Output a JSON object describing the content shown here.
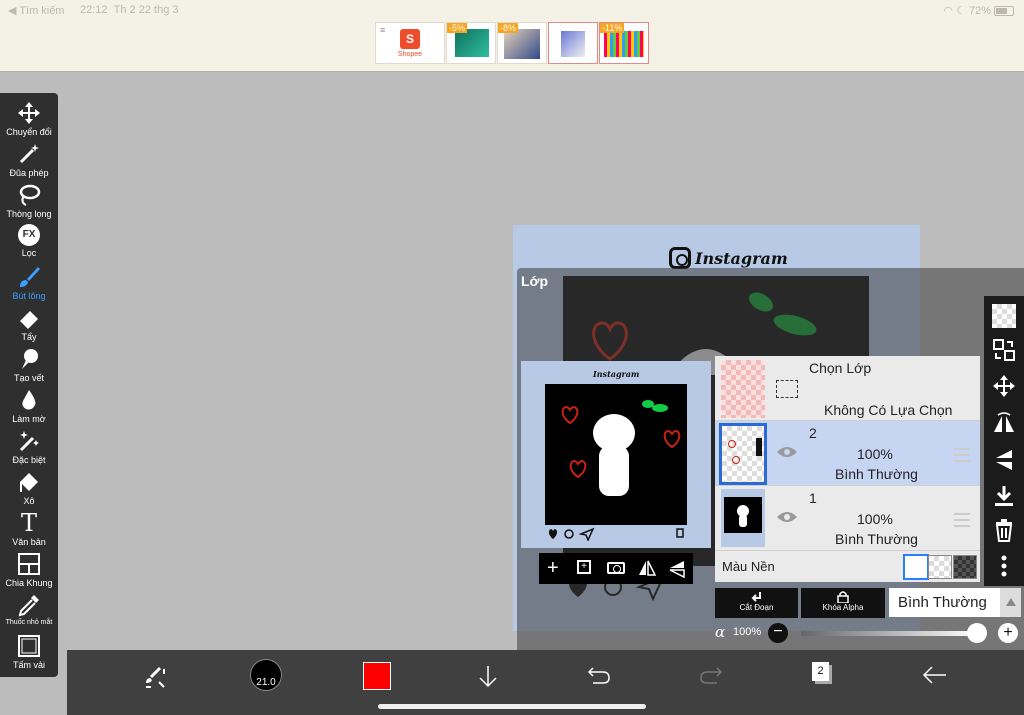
{
  "status": {
    "back": "◀ Tìm kiếm",
    "time": "22:12",
    "date": "Th 2 22 thg 3",
    "battery": "72%"
  },
  "ads": {
    "shopee": "Shopee",
    "badge1": "-5%",
    "badge2": "-8%",
    "badge3": "-11%"
  },
  "toolbar": {
    "items": [
      {
        "label": "Chuyển đổi"
      },
      {
        "label": "Đũa phép"
      },
      {
        "label": "Thòng lọng"
      },
      {
        "label": "Lọc"
      },
      {
        "label": "Bút lông"
      },
      {
        "label": "Tẩy"
      },
      {
        "label": "Tạo vết"
      },
      {
        "label": "Làm mờ"
      },
      {
        "label": "Đặc biệt"
      },
      {
        "label": "Xô"
      },
      {
        "label": "Văn bản"
      },
      {
        "label": "Chia Khung"
      },
      {
        "label": "Thuốc nhỏ mắt"
      },
      {
        "label": "Tấm vải"
      }
    ],
    "fx_glyph": "FX",
    "text_glyph": "T",
    "active_color": "#3aa0ff"
  },
  "canvas": {
    "instagram_label": "Instagram"
  },
  "layer_panel": {
    "title": "Lớp",
    "select_layer": {
      "title": "Chọn Lớp",
      "status": "Không Có Lựa Chọn"
    },
    "layers": [
      {
        "number": "2",
        "opacity": "100%",
        "blend": "Bình Thường"
      },
      {
        "number": "1",
        "opacity": "100%",
        "blend": "Bình Thường"
      }
    ],
    "background_label": "Màu Nền",
    "cut_label": "Cắt Đoạn",
    "alpha_lock_label": "Khóa Alpha",
    "blend_mode": "Bình Thường",
    "alpha_symbol": "α",
    "alpha_value": "100%",
    "alpha_level": 1.0
  },
  "bottombar": {
    "brush_size": "21.0",
    "layer_count": "2",
    "color": "#ff0000"
  }
}
